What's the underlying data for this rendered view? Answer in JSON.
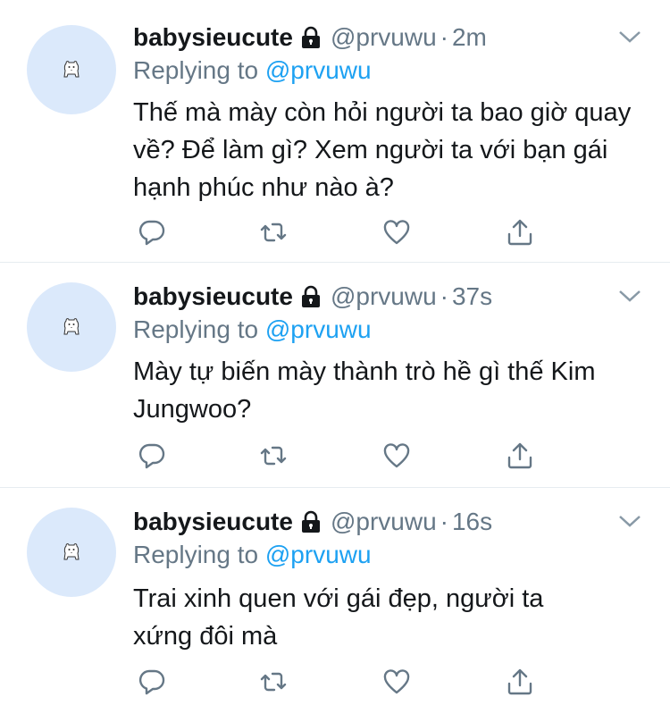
{
  "colors": {
    "link": "#1da1f2",
    "muted": "#657786",
    "text": "#14171a",
    "avatar_bg": "#dbe9fb"
  },
  "icons": [
    "avatar-bear-icon",
    "lock-icon",
    "chevron-down-icon",
    "reply-icon",
    "retweet-icon",
    "like-icon",
    "share-icon"
  ],
  "tweets": [
    {
      "name": "babysieucute",
      "handle": "@prvuwu",
      "dot": "·",
      "time": "2m",
      "replying_prefix": "Replying to",
      "replying_to": "@prvuwu",
      "text": "Thế mà mày còn hỏi người ta bao giờ quay về? Để làm gì? Xem người ta với bạn gái hạnh phúc như nào à?"
    },
    {
      "name": "babysieucute",
      "handle": "@prvuwu",
      "dot": "·",
      "time": "37s",
      "replying_prefix": "Replying to",
      "replying_to": "@prvuwu",
      "text": "Mày tự biến mày thành trò hề gì thế Kim Jungwoo?"
    },
    {
      "name": "babysieucute",
      "handle": "@prvuwu",
      "dot": "·",
      "time": "16s",
      "replying_prefix": "Replying to",
      "replying_to": "@prvuwu",
      "text": "Trai xinh quen với gái đẹp, người ta xứng đôi mà"
    }
  ]
}
